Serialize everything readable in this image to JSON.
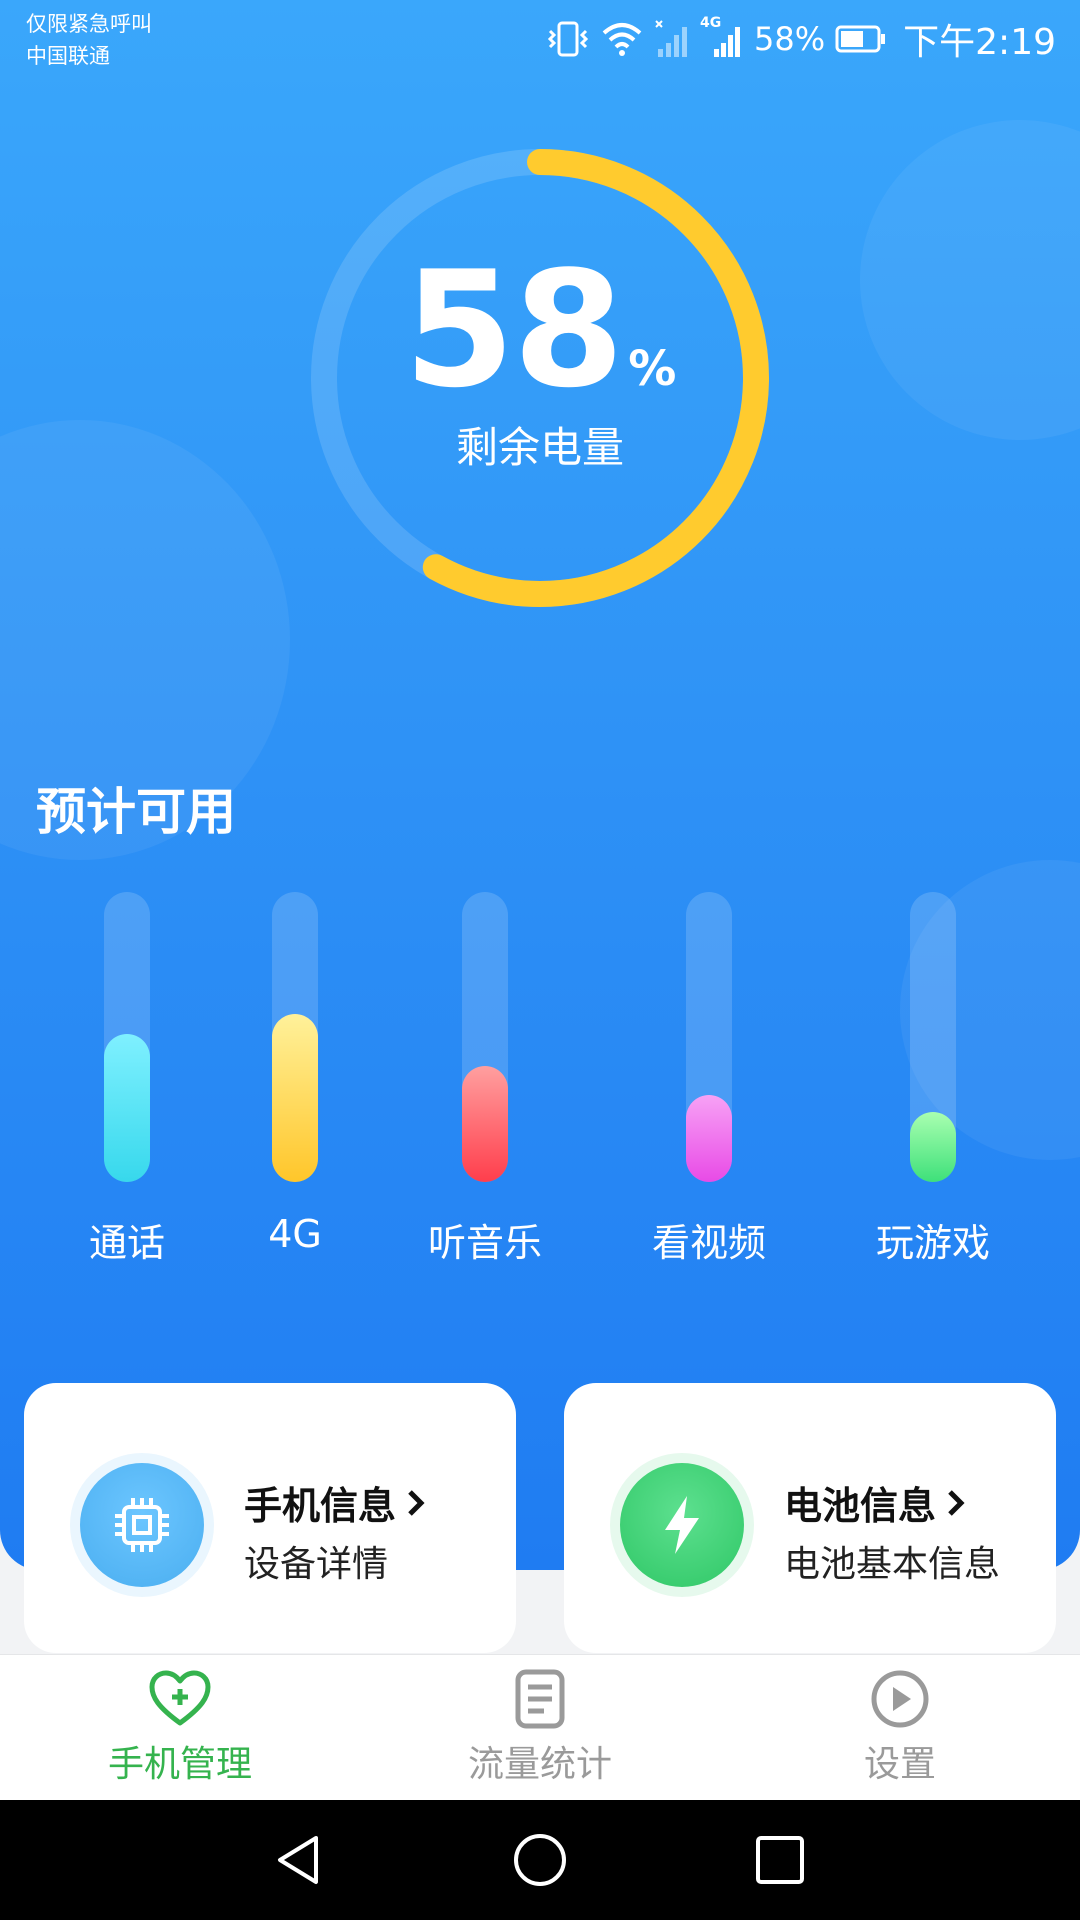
{
  "status_bar": {
    "line1": "仅限紧急呼叫",
    "line2": "中国联通",
    "network": "4G",
    "battery": "58%",
    "time": "下午2:19"
  },
  "battery_ring": {
    "percent": "58",
    "percent_sign": "%",
    "label": "剩余电量",
    "level": 0.58
  },
  "section_title": "预计可用",
  "usage_bars": [
    {
      "label": "通话",
      "level": 0.51,
      "color_top": "#7ff0ff",
      "color_bottom": "#37d8ec"
    },
    {
      "label": "4G",
      "level": 0.58,
      "color_top": "#fff19a",
      "color_bottom": "#ffc62a"
    },
    {
      "label": "听音乐",
      "level": 0.4,
      "color_top": "#ff9f9f",
      "color_bottom": "#ff3e4c"
    },
    {
      "label": "看视频",
      "level": 0.3,
      "color_top": "#f7a2f5",
      "color_bottom": "#e84be6"
    },
    {
      "label": "玩游戏",
      "level": 0.24,
      "color_top": "#a9ffb0",
      "color_bottom": "#3ee07a"
    }
  ],
  "cards": {
    "phone": {
      "title": "手机信息",
      "subtitle": "设备详情",
      "icon": "chip-icon",
      "color": "#4fb2f3"
    },
    "battery": {
      "title": "电池信息",
      "subtitle": "电池基本信息",
      "icon": "lightning-icon",
      "color": "#2fcf6a"
    }
  },
  "nav": {
    "items": [
      {
        "label": "手机管理",
        "icon": "heart-plus-icon",
        "active": true
      },
      {
        "label": "流量统计",
        "icon": "document-icon",
        "active": false
      },
      {
        "label": "设置",
        "icon": "play-circle-icon",
        "active": false
      }
    ],
    "active_color": "#35b34e",
    "inactive_color": "#9a9a9a"
  },
  "system_nav": {
    "back": "back-icon",
    "home": "home-icon",
    "recents": "recents-icon"
  }
}
